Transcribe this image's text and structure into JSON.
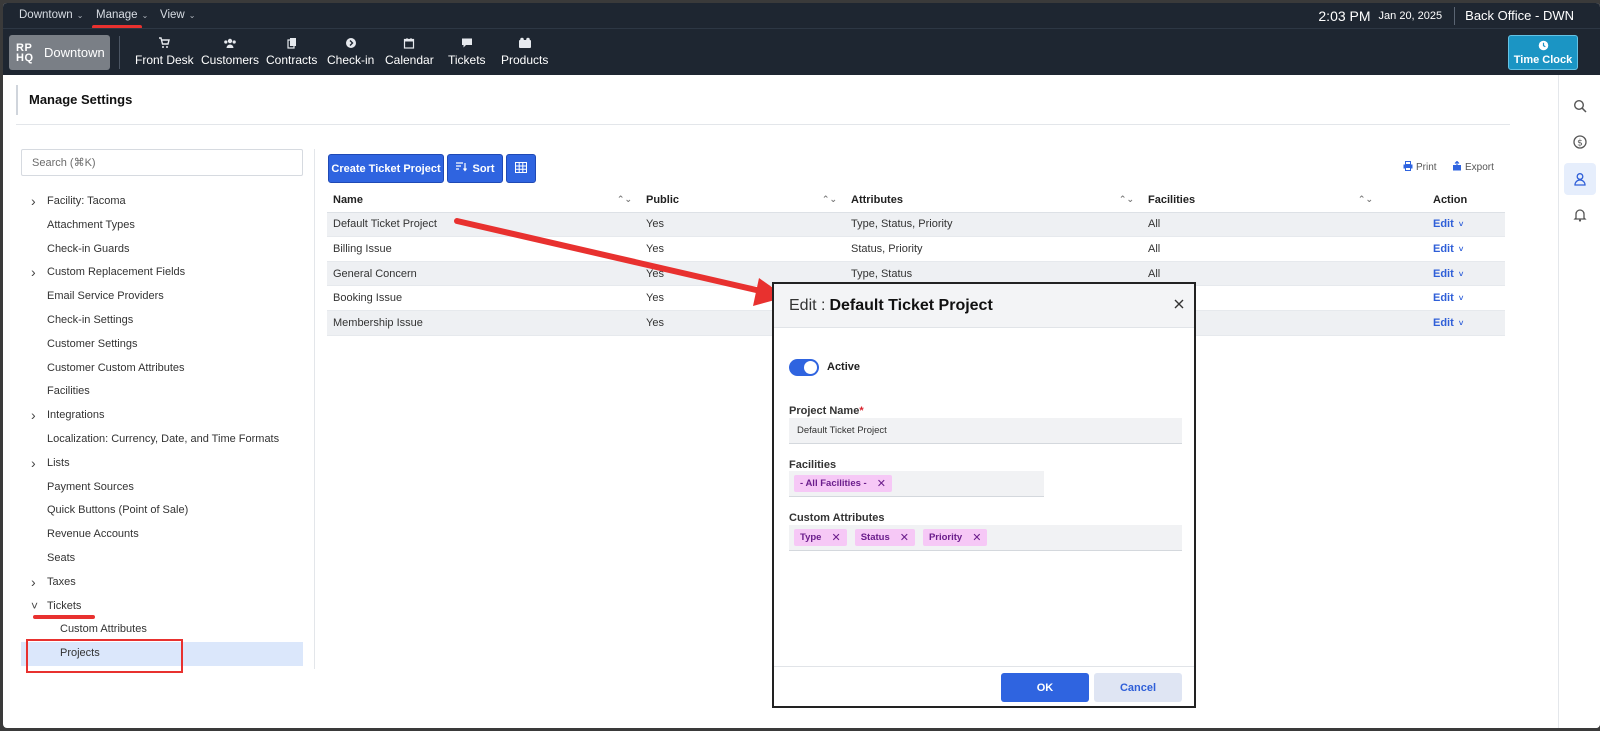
{
  "menubar": {
    "menus": [
      "Downtown",
      "Manage",
      "View"
    ],
    "time": "2:03 PM",
    "date": "Jan 20, 2025",
    "office": "Back Office - DWN"
  },
  "navbar": {
    "brand_logo_top": "RP",
    "brand_logo_bottom": "HQ",
    "brand_name": "Downtown",
    "items": [
      "Front Desk",
      "Customers",
      "Contracts",
      "Check-in",
      "Calendar",
      "Tickets",
      "Products"
    ],
    "time_clock": "Time Clock"
  },
  "page": {
    "title": "Manage Settings"
  },
  "sidebar": {
    "search_placeholder": "Search (⌘K)",
    "items": [
      {
        "label": "Facility: Tacoma",
        "expandable": true
      },
      {
        "label": "Attachment Types"
      },
      {
        "label": "Check-in Guards"
      },
      {
        "label": "Custom Replacement Fields",
        "expandable": true
      },
      {
        "label": "Email Service Providers"
      },
      {
        "label": "Check-in Settings"
      },
      {
        "label": "Customer Settings"
      },
      {
        "label": "Customer Custom Attributes"
      },
      {
        "label": "Facilities"
      },
      {
        "label": "Integrations",
        "expandable": true
      },
      {
        "label": "Localization: Currency, Date, and Time Formats"
      },
      {
        "label": "Lists",
        "expandable": true
      },
      {
        "label": "Payment Sources"
      },
      {
        "label": "Quick Buttons (Point of Sale)"
      },
      {
        "label": "Revenue Accounts"
      },
      {
        "label": "Seats"
      },
      {
        "label": "Taxes",
        "expandable": true
      },
      {
        "label": "Tickets",
        "expanded": true
      },
      {
        "label": "Custom Attributes",
        "child": true
      },
      {
        "label": "Projects",
        "child": true,
        "selected": true
      }
    ]
  },
  "toolbar": {
    "create_label": "Create Ticket Project",
    "sort_label": "Sort",
    "print_label": "Print",
    "export_label": "Export"
  },
  "table": {
    "headers": [
      "Name",
      "Public",
      "Attributes",
      "Facilities",
      "Action"
    ],
    "rows": [
      {
        "name": "Default Ticket Project",
        "public": "Yes",
        "attributes": "Type, Status, Priority",
        "facilities": "All",
        "action": "Edit"
      },
      {
        "name": "Billing Issue",
        "public": "Yes",
        "attributes": "Status, Priority",
        "facilities": "All",
        "action": "Edit"
      },
      {
        "name": "General Concern",
        "public": "Yes",
        "attributes": "Type, Status",
        "facilities": "All",
        "action": "Edit"
      },
      {
        "name": "Booking Issue",
        "public": "Yes",
        "attributes": "",
        "facilities": "",
        "action": "Edit"
      },
      {
        "name": "Membership Issue",
        "public": "Yes",
        "attributes": "",
        "facilities": "",
        "action": "Edit"
      }
    ]
  },
  "modal": {
    "title_prefix": "Edit :",
    "title": "Default Ticket Project",
    "active_label": "Active",
    "project_name_label": "Project Name",
    "project_name_value": "Default Ticket Project",
    "facilities_label": "Facilities",
    "facilities_chips": [
      "- All Facilities -"
    ],
    "custom_attributes_label": "Custom Attributes",
    "attribute_chips": [
      "Type",
      "Status",
      "Priority"
    ],
    "ok_label": "OK",
    "cancel_label": "Cancel"
  },
  "colors": {
    "primary": "#2f64e0",
    "topbar": "#1e2631",
    "time_clock": "#1b95c4",
    "annotation_red": "#e8312f",
    "chip_bg": "#f6c8f6"
  }
}
